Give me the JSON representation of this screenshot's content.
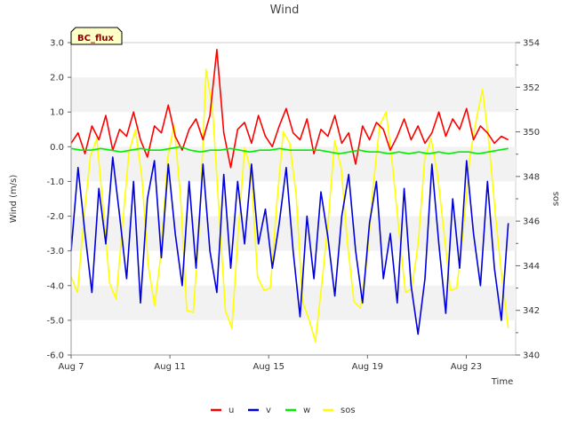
{
  "chart_data": {
    "type": "line",
    "title": "Wind",
    "badge": "BC_flux",
    "xlabel": "Time",
    "ylabel": "Wind (m/s)",
    "y2label": "sos",
    "x_start": "Aug 7",
    "x_end": "Aug 24 12:00",
    "xlim_days": [
      0,
      18.0
    ],
    "data_end_day": 17.7,
    "x_ticks": [
      {
        "label": "Aug 7",
        "day": 0
      },
      {
        "label": "Aug 11",
        "day": 4
      },
      {
        "label": "Aug 15",
        "day": 8
      },
      {
        "label": "Aug 19",
        "day": 12
      },
      {
        "label": "Aug 23",
        "day": 16
      }
    ],
    "ylim": [
      -6.0,
      3.0
    ],
    "y_ticks": [
      "3.0",
      "2.0",
      "1.0",
      "0.0",
      "-1.0",
      "-2.0",
      "-3.0",
      "-4.0",
      "-5.0",
      "-6.0"
    ],
    "y_tick_values": [
      3,
      2,
      1,
      0,
      -1,
      -2,
      -3,
      -4,
      -5,
      -6
    ],
    "y2lim": [
      340,
      354
    ],
    "y2_ticks": [
      "354",
      "352",
      "350",
      "348",
      "346",
      "344",
      "342",
      "340"
    ],
    "y2_tick_values": [
      354,
      352,
      350,
      348,
      346,
      344,
      342,
      340
    ],
    "grid_bands": true,
    "legend_position": "bottom-center",
    "series": [
      {
        "name": "u",
        "axis": "left",
        "color": "#ff0000",
        "values": [
          0.1,
          0.4,
          -0.2,
          0.6,
          0.2,
          0.9,
          -0.1,
          0.5,
          0.3,
          1.0,
          0.2,
          -0.3,
          0.6,
          0.4,
          1.2,
          0.3,
          -0.1,
          0.5,
          0.8,
          0.2,
          0.9,
          2.8,
          0.4,
          -0.6,
          0.5,
          0.7,
          0.1,
          0.9,
          0.3,
          0.0,
          0.6,
          1.1,
          0.4,
          0.2,
          0.8,
          -0.2,
          0.5,
          0.3,
          0.9,
          0.1,
          0.4,
          -0.5,
          0.6,
          0.2,
          0.7,
          0.5,
          -0.1,
          0.3,
          0.8,
          0.2,
          0.6,
          0.1,
          0.4,
          1.0,
          0.3,
          0.8,
          0.5,
          1.1,
          0.2,
          0.6,
          0.4,
          0.1,
          0.3,
          0.2
        ]
      },
      {
        "name": "v",
        "axis": "left",
        "color": "#0000dd",
        "values": [
          -3.0,
          -0.6,
          -2.5,
          -4.2,
          -1.2,
          -2.8,
          -0.3,
          -2.0,
          -3.8,
          -1.0,
          -4.5,
          -1.5,
          -0.4,
          -3.2,
          -0.5,
          -2.5,
          -4.0,
          -1.0,
          -3.5,
          -0.5,
          -3.0,
          -4.2,
          -0.8,
          -3.5,
          -1.0,
          -2.8,
          -0.5,
          -2.8,
          -1.8,
          -3.5,
          -2.2,
          -0.6,
          -3.0,
          -4.9,
          -2.0,
          -3.8,
          -1.3,
          -2.6,
          -4.3,
          -2.0,
          -0.8,
          -3.0,
          -4.5,
          -2.2,
          -1.0,
          -3.8,
          -2.5,
          -4.5,
          -1.2,
          -4.0,
          -5.4,
          -3.8,
          -0.5,
          -2.8,
          -4.8,
          -1.5,
          -3.5,
          -0.4,
          -2.5,
          -4.0,
          -1.0,
          -3.5,
          -5.0,
          -2.2
        ]
      },
      {
        "name": "w",
        "axis": "left",
        "color": "#00ee00",
        "values": [
          -0.05,
          -0.1,
          -0.1,
          -0.05,
          -0.1,
          -0.15,
          -0.1,
          -0.05,
          -0.1,
          -0.1,
          -0.05,
          0.0,
          -0.1,
          -0.15,
          -0.1,
          -0.1,
          -0.05,
          -0.1,
          -0.15,
          -0.1,
          -0.1,
          -0.05,
          -0.1,
          -0.1,
          -0.1,
          -0.1,
          -0.15,
          -0.2,
          -0.15,
          -0.1,
          -0.15,
          -0.15,
          -0.2,
          -0.15,
          -0.2,
          -0.15,
          -0.2,
          -0.15,
          -0.2,
          -0.15,
          -0.15,
          -0.2,
          -0.15,
          -0.1,
          -0.05
        ]
      },
      {
        "name": "sos",
        "axis": "right",
        "color": "#ffff00",
        "values": [
          343.5,
          342.8,
          346.2,
          348.9,
          349.7,
          346.5,
          343.2,
          342.5,
          345.8,
          349.1,
          350.1,
          348.0,
          344.0,
          342.2,
          344.6,
          348.8,
          350.3,
          347.2,
          342.0,
          341.9,
          346.0,
          352.8,
          351.0,
          346.5,
          342.0,
          341.2,
          345.5,
          349.3,
          348.2,
          343.5,
          342.9,
          343.0,
          346.8,
          350.0,
          349.5,
          347.2,
          342.4,
          341.6,
          340.6,
          343.2,
          346.0,
          349.6,
          348.4,
          345.0,
          342.4,
          342.1,
          344.2,
          347.6,
          350.3,
          350.9,
          348.5,
          345.6,
          342.8,
          343.0,
          345.0,
          348.8,
          349.7,
          348.1,
          345.5,
          342.9,
          343.0,
          345.6,
          348.8,
          350.5,
          351.9,
          349.5,
          346.3,
          343.5,
          341.2
        ]
      }
    ]
  }
}
